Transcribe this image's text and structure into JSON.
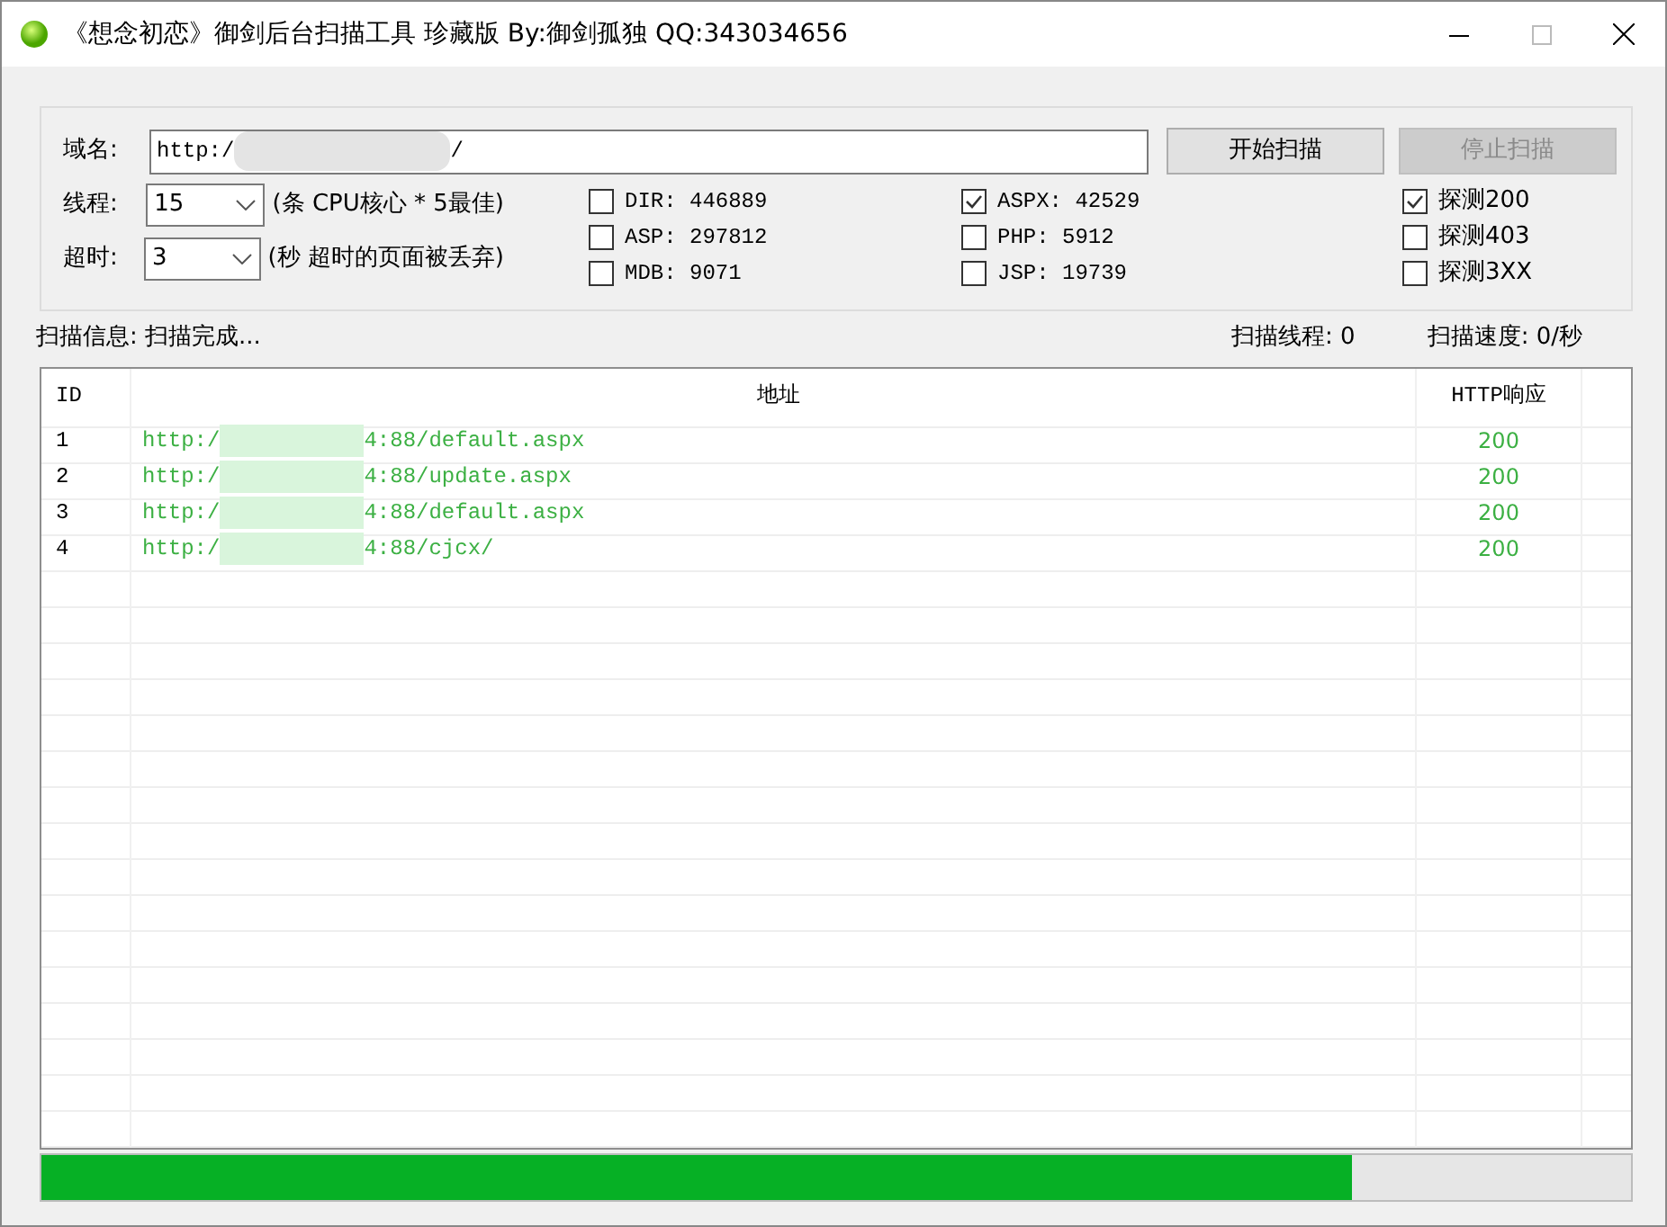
{
  "window": {
    "title": "《想念初恋》御剑后台扫描工具 珍藏版 By:御剑孤独 QQ:343034656"
  },
  "domain": {
    "label": "域名:",
    "value_start": "http:/",
    "value_end": "/"
  },
  "threads": {
    "label": "线程:",
    "value": "15",
    "hint": "(条 CPU核心 * 5最佳)"
  },
  "timeout": {
    "label": "超时:",
    "value": "3",
    "hint": "(秒 超时的页面被丢弃)"
  },
  "buttons": [
    {
      "label": "开始扫描",
      "disabled": false
    },
    {
      "label": "停止扫描",
      "disabled": true
    }
  ],
  "dictionaries": [
    {
      "label": "DIR: 446889",
      "checked": false
    },
    {
      "label": "ASP: 297812",
      "checked": false
    },
    {
      "label": "MDB: 9071",
      "checked": false
    },
    {
      "label": "ASPX: 42529",
      "checked": true
    },
    {
      "label": "PHP: 5912",
      "checked": false
    },
    {
      "label": "JSP: 19739",
      "checked": false
    }
  ],
  "probes": [
    {
      "label": "探测200",
      "checked": true
    },
    {
      "label": "探测403",
      "checked": false
    },
    {
      "label": "探测3XX",
      "checked": false
    }
  ],
  "status": {
    "info": "扫描信息: 扫描完成...",
    "threads": "扫描线程: 0",
    "speed": "扫描速度: 0/秒"
  },
  "table": {
    "columns": [
      "ID",
      "地址",
      "HTTP响应"
    ],
    "rows": [
      {
        "id": "1",
        "url_start": "http:/",
        "url_end": "4:88/default.aspx",
        "code": "200"
      },
      {
        "id": "2",
        "url_start": "http:/",
        "url_end": "4:88/update.aspx",
        "code": "200"
      },
      {
        "id": "3",
        "url_start": "http:/",
        "url_end": "4:88/default.aspx",
        "code": "200"
      },
      {
        "id": "4",
        "url_start": "http:/",
        "url_end": "4:88/cjcx/",
        "code": "200"
      }
    ]
  },
  "progress": {
    "level": 0.825
  }
}
